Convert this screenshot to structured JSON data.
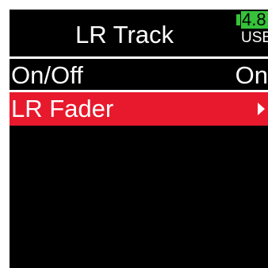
{
  "header": {
    "title": "LR Track",
    "battery_level": "4.8",
    "battery_source": "USB",
    "battery_color": "#36c23a"
  },
  "menu": {
    "items": [
      {
        "label": "On/Off",
        "value": "On"
      },
      {
        "label": "LR Fader",
        "icon": "arrow-right-icon"
      }
    ],
    "selected_index": 1,
    "selection_color": "#e8192c"
  }
}
